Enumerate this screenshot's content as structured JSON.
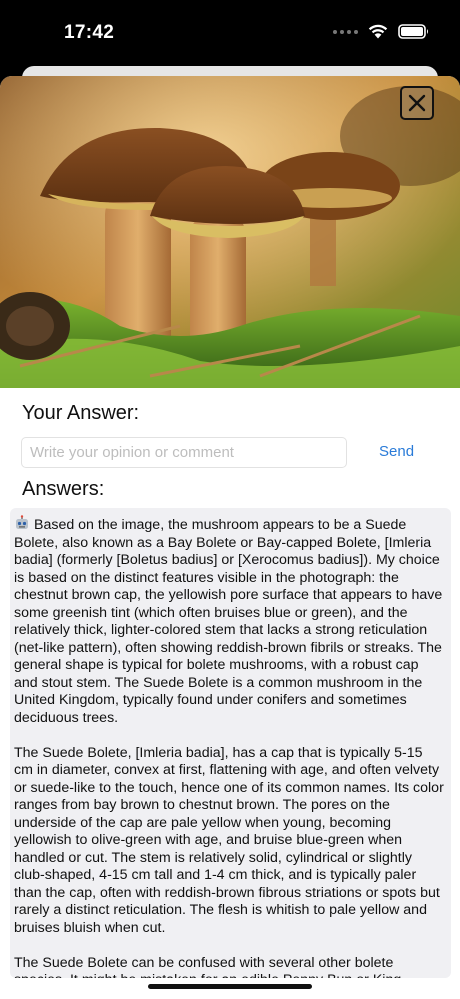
{
  "status_bar": {
    "time": "17:42"
  },
  "icons": {
    "signal": "cellular-signal-icon",
    "wifi": "wifi-icon",
    "battery": "battery-icon",
    "close": "close-icon",
    "bot": "robot-icon"
  },
  "photo": {
    "subject": "Two brown bolete mushrooms growing in green moss"
  },
  "answer_form": {
    "title": "Your Answer:",
    "input_value": "",
    "input_placeholder": "Write your opinion or comment",
    "send_label": "Send"
  },
  "answers": {
    "title": "Answers:",
    "paragraphs": [
      "Based on the image, the mushroom appears to be a Suede Bolete, also known as a Bay Bolete or Bay-capped Bolete, [Imleria badia] (formerly [Boletus badius] or [Xerocomus badius]). My choice is based on the distinct features visible in the photograph: the chestnut brown cap, the yellowish pore surface that appears to have some greenish tint (which often bruises blue or green), and the relatively thick, lighter-colored stem that lacks a strong reticulation (net-like pattern), often showing reddish-brown fibrils or streaks. The general shape is typical for bolete mushrooms, with a robust cap and stout stem. The Suede Bolete is a common mushroom in the United Kingdom, typically found under conifers and sometimes deciduous trees.",
      "The Suede Bolete, [Imleria badia], has a cap that is typically 5-15 cm in diameter, convex at first, flattening with age, and often velvety or suede-like to the touch, hence one of its common names. Its color ranges from bay brown to chestnut brown. The pores on the underside of the cap are pale yellow when young, becoming yellowish to olive-green with age, and bruise blue-green when handled or cut. The stem is relatively solid, cylindrical or slightly club-shaped, 4-15 cm tall and 1-4 cm thick, and is typically paler than the cap, often with reddish-brown fibrous striations or spots but rarely a distinct reticulation. The flesh is whitish to pale yellow and bruises bluish when cut.",
      "The Suede Bolete can be confused with several other bolete species. It might be mistaken for an edible Penny Bun or King"
    ]
  }
}
